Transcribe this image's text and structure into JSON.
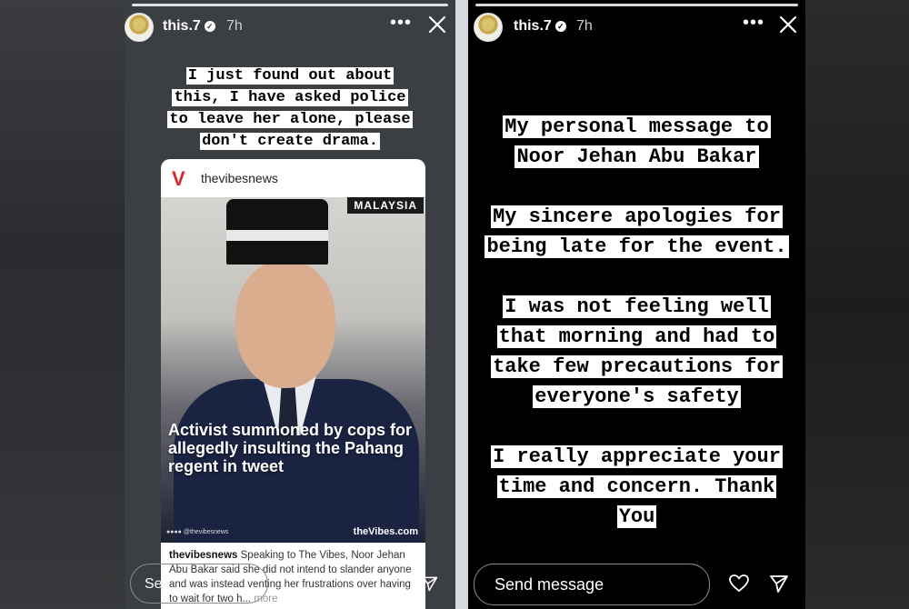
{
  "left_story": {
    "username": "this.7",
    "time": "7h",
    "caption_lines": [
      "I just found out about",
      "this, I have asked police",
      "to leave her alone, please",
      "don't create drama."
    ],
    "card": {
      "account": "thevibesnews",
      "country_tag": "MALAYSIA",
      "headline": "Activist summoned by cops for allegedly insulting the Pahang regent in tweet",
      "brand": "theVibes.com",
      "social_row": "●●●● @thevibesnews",
      "post_user": "thevibesnews",
      "post_text": "Speaking to The Vibes, Noor Jehan Abu Bakar said she did not intend to slander anyone and was instead venting her frustrations over having to wait for two h...",
      "more_label": "more"
    },
    "send_message_label": "Se"
  },
  "right_story": {
    "username": "this.7",
    "time": "7h",
    "paragraphs": [
      [
        "My personal message to",
        "Noor Jehan Abu Bakar"
      ],
      [
        "My sincere apologies for",
        "being late for the event."
      ],
      [
        "I was not feeling well",
        "that morning and had to",
        "take few precautions for",
        "everyone's safety"
      ],
      [
        "I really appreciate your",
        "time and concern. Thank",
        "You"
      ]
    ],
    "send_message_label": "Send message"
  },
  "icons": {
    "more": "more-options-icon",
    "close": "close-icon",
    "heart": "heart-icon",
    "send": "send-icon",
    "verified": "verified-badge-icon"
  },
  "colors": {
    "left_bg": "#3b3e43",
    "right_bg": "#000000",
    "highlight_bg": "#ffffff",
    "highlight_text": "#000000",
    "brand_red": "#d62828"
  }
}
